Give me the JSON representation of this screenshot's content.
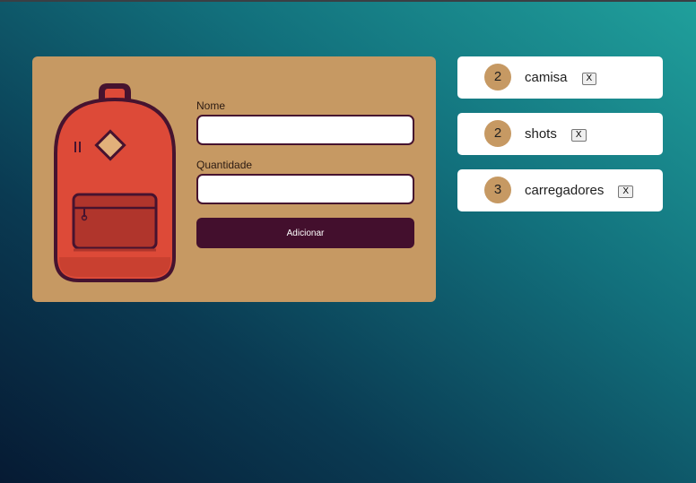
{
  "form": {
    "name_label": "Nome",
    "quantity_label": "Quantidade",
    "name_value": "",
    "quantity_value": "",
    "submit_label": "Adicionar"
  },
  "items": [
    {
      "quantity": "2",
      "name": "camisa",
      "remove_label": "X"
    },
    {
      "quantity": "2",
      "name": "shots",
      "remove_label": "X"
    },
    {
      "quantity": "3",
      "name": "carregadores",
      "remove_label": "X"
    }
  ],
  "colors": {
    "card": "#c69963",
    "button": "#430f2d",
    "backpack": "#dd4a38",
    "outline": "#46132f"
  },
  "icons": {
    "illustration": "backpack-icon"
  }
}
